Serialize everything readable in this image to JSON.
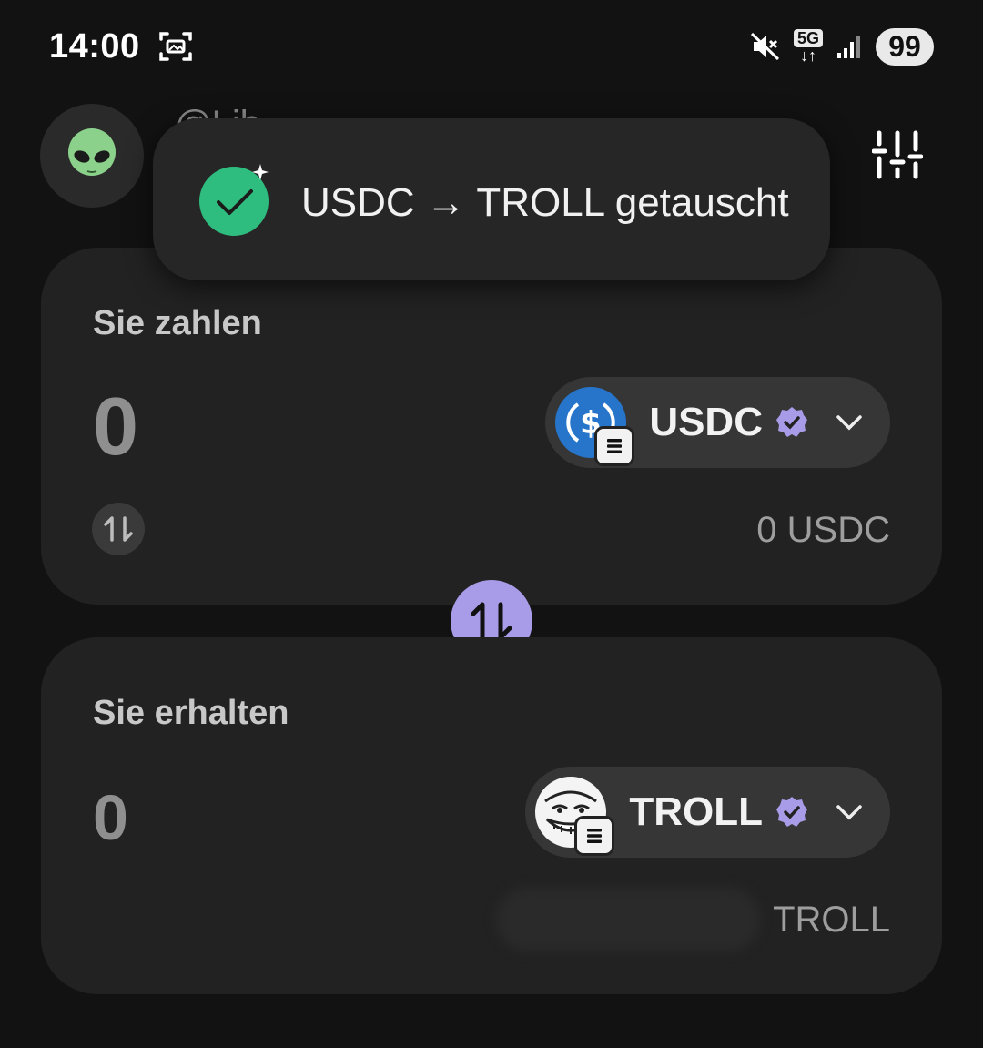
{
  "status_bar": {
    "time": "14:00",
    "network": "5G",
    "battery": "99"
  },
  "header": {
    "username": "@Lib"
  },
  "toast": {
    "message": "USDC → TROLL getauscht"
  },
  "pay": {
    "label": "Sie zahlen",
    "amount": "0",
    "token": "USDC",
    "balance": "0 USDC"
  },
  "receive": {
    "label": "Sie erhalten",
    "amount": "0",
    "token": "TROLL",
    "balance": "TROLL"
  },
  "colors": {
    "accent": "#a89be8",
    "success": "#2ebd7f",
    "usdc": "#2775ca"
  },
  "icons": [
    "screenshot-icon",
    "mute-icon",
    "signal-icon",
    "alien-icon",
    "settings-sliders-icon",
    "check-icon",
    "swap-icon",
    "verified-icon",
    "chevron-down-icon",
    "solana-icon"
  ]
}
